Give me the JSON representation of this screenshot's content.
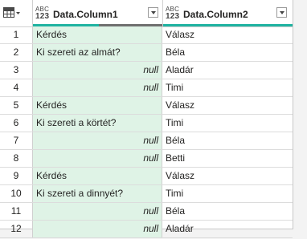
{
  "header": {
    "type_icon_top": "ABC",
    "type_icon_bottom": "123",
    "columns": [
      {
        "name": "Data.Column1"
      },
      {
        "name": "Data.Column2"
      }
    ]
  },
  "rows": [
    {
      "n": "1",
      "c1": "Kérdés",
      "c2": "Válasz"
    },
    {
      "n": "2",
      "c1": "Ki szereti az almát?",
      "c2": "Béla"
    },
    {
      "n": "3",
      "c1": "null",
      "c2": "Aladár"
    },
    {
      "n": "4",
      "c1": "null",
      "c2": "Timi"
    },
    {
      "n": "5",
      "c1": "Kérdés",
      "c2": "Válasz"
    },
    {
      "n": "6",
      "c1": "Ki szereti a körtét?",
      "c2": "Timi"
    },
    {
      "n": "7",
      "c1": "null",
      "c2": "Béla"
    },
    {
      "n": "8",
      "c1": "null",
      "c2": "Betti"
    },
    {
      "n": "9",
      "c1": "Kérdés",
      "c2": "Válasz"
    },
    {
      "n": "10",
      "c1": "Ki szereti a dinnyét?",
      "c2": "Timi"
    },
    {
      "n": "11",
      "c1": "null",
      "c2": "Béla"
    },
    {
      "n": "12",
      "c1": "null",
      "c2": "Aladár"
    }
  ],
  "colors": {
    "selected_column_bg": "#dff3e6",
    "quality_valid": "#1fb3a1",
    "quality_empty": "#6f6f6f"
  },
  "column_quality": {
    "Data.Column1": {
      "valid_fraction": 0.5,
      "empty_fraction": 0.5
    },
    "Data.Column2": {
      "valid_fraction": 1.0
    }
  }
}
